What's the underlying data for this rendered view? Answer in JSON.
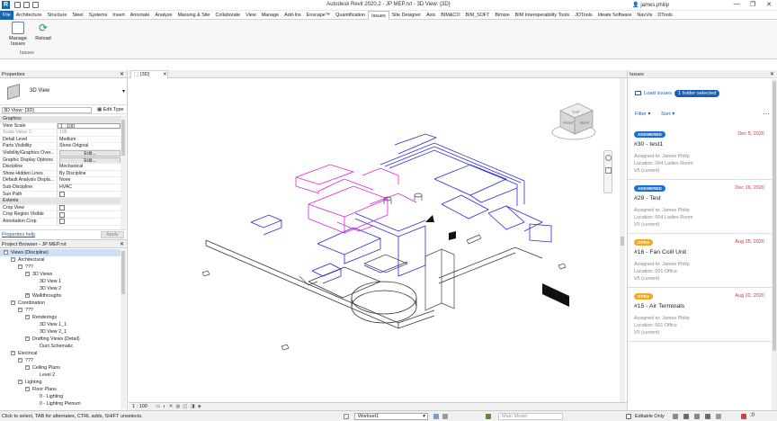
{
  "window": {
    "title": "Autodesk Revit 2020.2 - JP MEP.rvt - 3D View: {3D}",
    "user": "james.philip",
    "controls": [
      "—",
      "❐",
      "✕"
    ]
  },
  "ribbon_tabs": [
    "File",
    "Architecture",
    "Structure",
    "Steel",
    "Systems",
    "Insert",
    "Annotate",
    "Analyze",
    "Massing & Site",
    "Collaborate",
    "View",
    "Manage",
    "Add-Ins",
    "Enscape™",
    "Quantification",
    "Issues",
    "Site Designer",
    "Axis",
    "BIM&CO",
    "BIM_SOFT",
    "Bimize",
    "BIM Interoperability Tools",
    "JOTools",
    "Ideate Software",
    "NavVis",
    "DTools"
  ],
  "active_tab": "Issues",
  "ribbon": {
    "manage_label": "Manage Issues",
    "reload_label": "Reload",
    "group_label": "Issues"
  },
  "properties": {
    "header": "Properties",
    "type_name": "3D View",
    "view_selector": "3D View: {3D}",
    "edit_type": "Edit Type",
    "rows": [
      {
        "k": "Graphics",
        "v": "",
        "sec": true
      },
      {
        "k": "View Scale",
        "v": "1 : 100",
        "input": true
      },
      {
        "k": "Scale Value    1:",
        "v": "100",
        "grey": true
      },
      {
        "k": "Detail Level",
        "v": "Medium"
      },
      {
        "k": "Parts Visibility",
        "v": "Show Original"
      },
      {
        "k": "Visibility/Graphics Over...",
        "v": "Edit...",
        "btn": true
      },
      {
        "k": "Graphic Display Options",
        "v": "Edit...",
        "btn": true
      },
      {
        "k": "Discipline",
        "v": "Mechanical"
      },
      {
        "k": "Show Hidden Lines",
        "v": "By Discipline"
      },
      {
        "k": "Default Analysis Displa...",
        "v": "None"
      },
      {
        "k": "Sub-Discipline",
        "v": "HVAC"
      },
      {
        "k": "Sun Path",
        "v": "",
        "cb": true
      },
      {
        "k": "Extents",
        "v": "",
        "sec": true
      },
      {
        "k": "Crop View",
        "v": "",
        "cb": true
      },
      {
        "k": "Crop Region Visible",
        "v": "",
        "cb": true
      },
      {
        "k": "Annotation Crop",
        "v": "",
        "cb": true
      }
    ],
    "help_link": "Properties help",
    "apply": "Apply"
  },
  "browser": {
    "header": "Project Browser - JP MEP.rvt",
    "tree": [
      {
        "d": 0,
        "t": "Views (Discipline)",
        "tog": "-"
      },
      {
        "d": 1,
        "t": "Architectural",
        "tog": "-"
      },
      {
        "d": 2,
        "t": "???",
        "tog": "-"
      },
      {
        "d": 3,
        "t": "3D Views",
        "tog": "-"
      },
      {
        "d": 4,
        "t": "3D View 1"
      },
      {
        "d": 4,
        "t": "3D View 2"
      },
      {
        "d": 3,
        "t": "Walkthroughs",
        "tog": "+"
      },
      {
        "d": 1,
        "t": "Coordination",
        "tog": "-"
      },
      {
        "d": 2,
        "t": "???",
        "tog": "-"
      },
      {
        "d": 3,
        "t": "Renderings",
        "tog": "-"
      },
      {
        "d": 4,
        "t": "3D View 1_1"
      },
      {
        "d": 4,
        "t": "3D View 2_1"
      },
      {
        "d": 3,
        "t": "Drafting Views (Detail)",
        "tog": "-"
      },
      {
        "d": 4,
        "t": "Duct Schematic"
      },
      {
        "d": 1,
        "t": "Electrical",
        "tog": "-"
      },
      {
        "d": 2,
        "t": "???",
        "tog": "-"
      },
      {
        "d": 3,
        "t": "Ceiling Plans",
        "tog": "-"
      },
      {
        "d": 4,
        "t": "Level 2"
      },
      {
        "d": 2,
        "t": "Lighting",
        "tog": "-"
      },
      {
        "d": 3,
        "t": "Floor Plans",
        "tog": "-"
      },
      {
        "d": 4,
        "t": "0 - Lighting"
      },
      {
        "d": 4,
        "t": "0 - Lighting Plenum"
      }
    ]
  },
  "view": {
    "tab": "{3D}",
    "scale": "1 : 100",
    "cube_labels": [
      "TOP",
      "FRONT",
      "RIGHT"
    ]
  },
  "issues": {
    "header": "Issues",
    "load_label": "Load issues",
    "folder_pill": "1 folder selected",
    "filter": "Filter",
    "sort": "Sort",
    "more": "⋯",
    "cards": [
      {
        "status": "ANSWERED",
        "date": "Dec 5, 2020",
        "title": "#30 - test1",
        "assigned": "Assigned to: James Philip",
        "location": "Location: 004 Ladies Room",
        "version": "V5 (current)"
      },
      {
        "status": "ANSWERED",
        "date": "Dec 16, 2020",
        "title": "#29 - Test",
        "assigned": "Assigned to: James Philip",
        "location": "Location: 004 Ladies Room",
        "version": "V5 (current)"
      },
      {
        "status": "OPEN",
        "date": "Aug 25, 2020",
        "title": "#16 - Fan Coill Unit",
        "assigned": "Assigned to: James Philip",
        "location": "Location: 001 Office",
        "version": "V5 (current)"
      },
      {
        "status": "OPEN",
        "date": "Aug 22, 2020",
        "title": "#15 - Air Terminals",
        "assigned": "Assigned to: James Philip",
        "location": "Location: 001 Office",
        "version": "V5 (current)"
      }
    ]
  },
  "status_bar": {
    "message": "Click to select, TAB for alternates, CTRL adds, SHIFT unselects.",
    "workset": "Workset1",
    "model": "Main Model",
    "editable": "Editable Only"
  },
  "colors": {
    "accent": "#1a5fb4",
    "answered": "#1a6fd6",
    "open": "#f5a623",
    "duct_blue": "#2a2ad8",
    "duct_magenta": "#e020e0",
    "date_red": "#d33"
  }
}
